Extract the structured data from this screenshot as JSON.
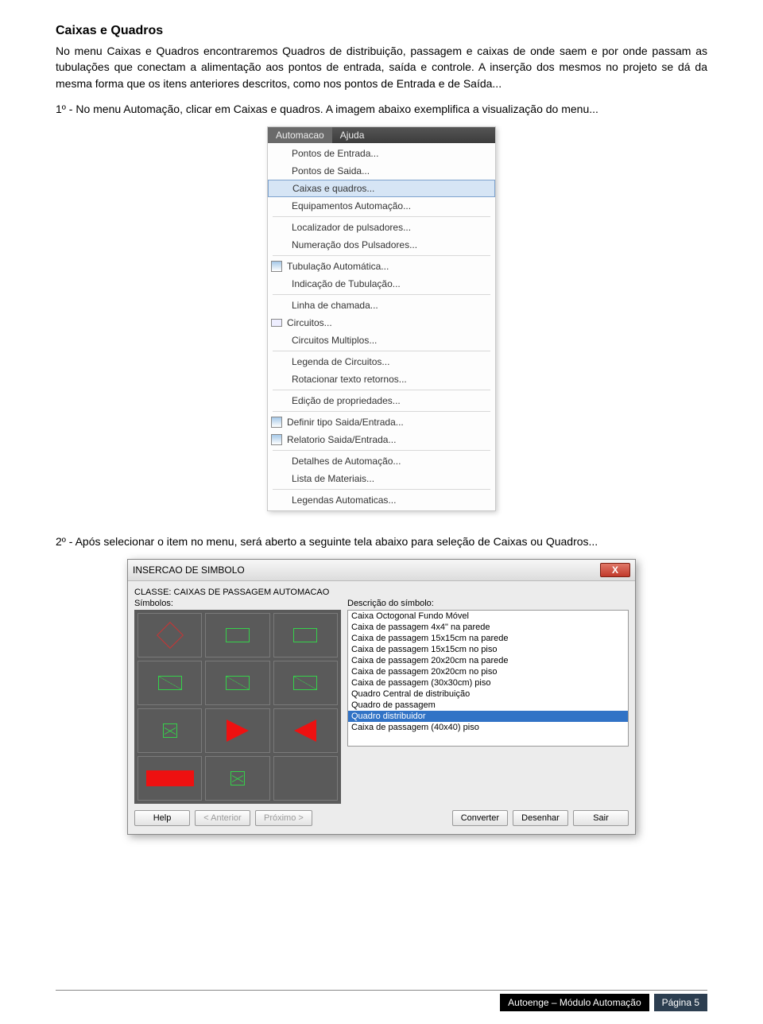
{
  "doc": {
    "title": "Caixas e Quadros",
    "para1": "No menu Caixas e Quadros encontraremos Quadros de distribuição, passagem e caixas de onde saem e por onde passam as tubulações que conectam a alimentação aos pontos de entrada, saída e controle. A inserção dos mesmos no projeto se dá da mesma forma que os itens anteriores descritos, como nos pontos de Entrada e de Saída...",
    "step1": "1º - No menu Automação, clicar em Caixas e quadros. A imagem abaixo exemplifica a visualização do menu...",
    "step2": "2º - Após selecionar o item no menu, será aberto a seguinte tela abaixo para seleção de Caixas ou Quadros..."
  },
  "menu": {
    "tabs": {
      "active": "Automacao",
      "other": "Ajuda"
    },
    "items": [
      {
        "label": "Pontos de Entrada...",
        "icon": "",
        "sep_after": false
      },
      {
        "label": "Pontos de Saida...",
        "icon": "",
        "sep_after": false
      },
      {
        "label": "Caixas e quadros...",
        "icon": "",
        "highlight": true,
        "sep_after": false
      },
      {
        "label": "Equipamentos Automação...",
        "icon": "",
        "sep_after": true
      },
      {
        "label": "Localizador de pulsadores...",
        "icon": "",
        "sep_after": false
      },
      {
        "label": "Numeração dos Pulsadores...",
        "icon": "",
        "sep_after": true
      },
      {
        "label": "Tubulação Automática...",
        "icon": "ed",
        "sep_after": false
      },
      {
        "label": "Indicação de Tubulação...",
        "icon": "",
        "sep_after": true
      },
      {
        "label": "Linha de chamada...",
        "icon": "",
        "sep_after": false
      },
      {
        "label": "Circuitos...",
        "icon": "circ",
        "sep_after": false
      },
      {
        "label": "Circuitos Multiplos...",
        "icon": "",
        "sep_after": true
      },
      {
        "label": "Legenda de Circuitos...",
        "icon": "",
        "sep_after": false
      },
      {
        "label": "Rotacionar texto retornos...",
        "icon": "",
        "sep_after": true
      },
      {
        "label": "Edição de propriedades...",
        "icon": "",
        "sep_after": true
      },
      {
        "label": "Definir tipo Saida/Entrada...",
        "icon": "ed",
        "sep_after": false
      },
      {
        "label": "Relatorio Saida/Entrada...",
        "icon": "ed",
        "sep_after": true
      },
      {
        "label": "Detalhes de Automação...",
        "icon": "",
        "sep_after": false
      },
      {
        "label": "Lista de Materiais...",
        "icon": "",
        "sep_after": true
      },
      {
        "label": "Legendas Automaticas...",
        "icon": "",
        "sep_after": false
      }
    ]
  },
  "dialog": {
    "title": "INSERCAO DE SIMBOLO",
    "close": "X",
    "class_label": "CLASSE: CAIXAS DE PASSAGEM AUTOMACAO",
    "simbolos_label": "Símbolos:",
    "desc_label": "Descrição do símbolo:",
    "desc_items": [
      "Caixa Octogonal Fundo Móvel",
      "Caixa de passagem 4x4\"  na parede",
      "Caixa de passagem 15x15cm na parede",
      "Caixa de passagem 15x15cm no piso",
      "Caixa de passagem 20x20cm na parede",
      "Caixa de passagem 20x20cm no piso",
      "Caixa de passagem (30x30cm) piso",
      "Quadro Central de distribuição",
      "Quadro de passagem",
      "Quadro distribuidor",
      "Caixa de passagem (40x40) piso"
    ],
    "selected_index": 9,
    "buttons": {
      "help": "Help",
      "prev": "< Anterior",
      "next": "Próximo >",
      "convert": "Converter",
      "draw": "Desenhar",
      "exit": "Sair"
    }
  },
  "footer": {
    "left": "Autoenge – Módulo Automação",
    "right": "Página 5"
  }
}
